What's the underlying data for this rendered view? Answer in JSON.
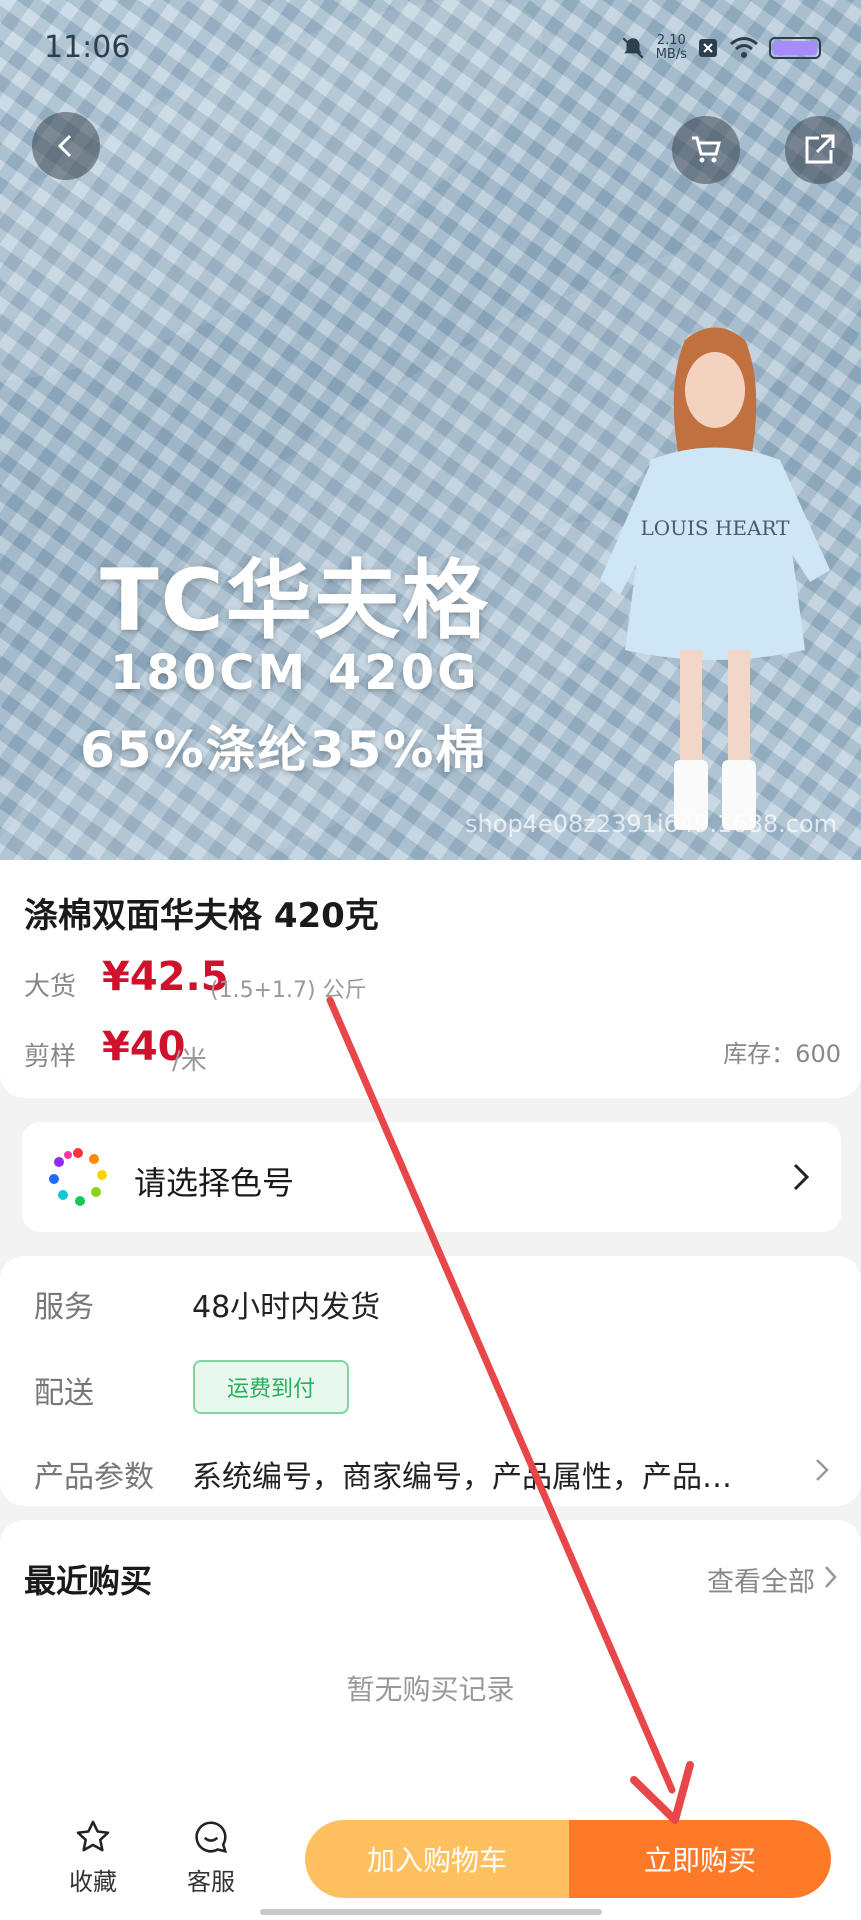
{
  "status_bar": {
    "time": "11:06",
    "net_speed_value": "2.10",
    "net_speed_unit": "MB/s"
  },
  "hero": {
    "title": "TC华夫格",
    "subtitle_1": "180CM 420G",
    "subtitle_2": "65%涤纶35%棉",
    "sweater_text": "LOUIS HEART",
    "watermark": "shop4e08z2391i649.1688.com"
  },
  "product": {
    "title": "涤棉双面华夫格 420克",
    "bulk_label": "大货",
    "bulk_price": "¥42.5",
    "bulk_note": "(1.5+1.7) 公斤",
    "sample_label": "剪样",
    "sample_price": "¥40",
    "sample_unit": "/米",
    "stock": "库存：600"
  },
  "color_selector": {
    "label": "请选择色号"
  },
  "info": {
    "service_label": "服务",
    "service_value": "48小时内发货",
    "delivery_label": "配送",
    "delivery_badge": "运费到付",
    "params_label": "产品参数",
    "params_value": "系统编号，商家编号，产品属性，产品…"
  },
  "recent": {
    "title": "最近购买",
    "view_all": "查看全部",
    "empty": "暂无购买记录"
  },
  "bottom_bar": {
    "favorite": "收藏",
    "service": "客服",
    "add_to_cart": "加入购物车",
    "buy_now": "立即购买"
  },
  "colors": {
    "price_red": "#d0112b",
    "cart_orange": "#ffc060",
    "buy_orange": "#ff7a28",
    "badge_green": "#27b058",
    "arrow_red": "#e8474a"
  }
}
